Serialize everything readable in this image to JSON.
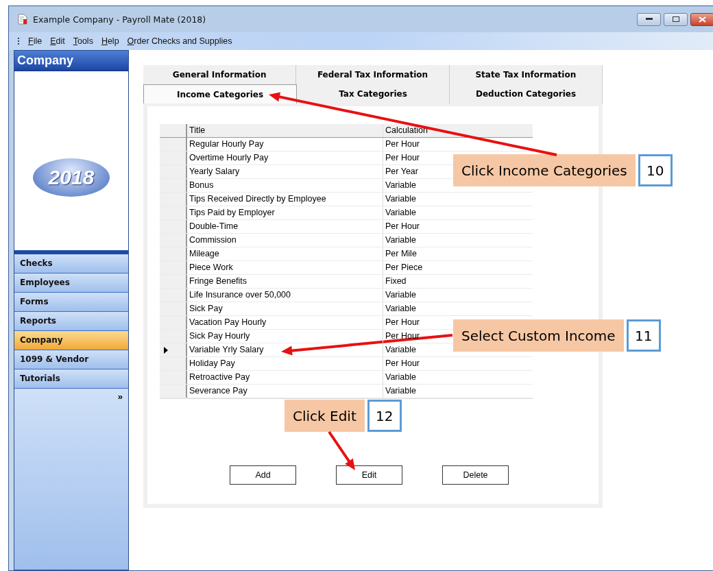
{
  "window": {
    "title": "Example Company - Payroll Mate (2018)"
  },
  "menu": [
    "File",
    "Edit",
    "Tools",
    "Help",
    "Order Checks and Supplies"
  ],
  "sidebar": {
    "header": "Company",
    "logo_text": "2018",
    "items": [
      {
        "label": "Checks",
        "selected": false
      },
      {
        "label": "Employees",
        "selected": false
      },
      {
        "label": "Forms",
        "selected": false
      },
      {
        "label": "Reports",
        "selected": false
      },
      {
        "label": "Company",
        "selected": true
      },
      {
        "label": "1099 & Vendor",
        "selected": false
      },
      {
        "label": "Tutorials",
        "selected": false
      }
    ],
    "more": "»"
  },
  "tabs": [
    [
      {
        "label": "General Information",
        "selected": false
      },
      {
        "label": "Federal Tax Information",
        "selected": false
      },
      {
        "label": "State Tax Information",
        "selected": false
      }
    ],
    [
      {
        "label": "Income Categories",
        "selected": true
      },
      {
        "label": "Tax Categories",
        "selected": false
      },
      {
        "label": "Deduction Categories",
        "selected": false
      }
    ]
  ],
  "table": {
    "columns": [
      "Title",
      "Calculation"
    ],
    "rows": [
      {
        "title": "Regular Hourly Pay",
        "calculation": "Per Hour",
        "selected": false
      },
      {
        "title": "Overtime Hourly Pay",
        "calculation": "Per Hour",
        "selected": false
      },
      {
        "title": "Yearly Salary",
        "calculation": "Per Year",
        "selected": false
      },
      {
        "title": "Bonus",
        "calculation": "Variable",
        "selected": false
      },
      {
        "title": "Tips Received Directly by Employee",
        "calculation": "Variable",
        "selected": false
      },
      {
        "title": "Tips Paid by Employer",
        "calculation": "Variable",
        "selected": false
      },
      {
        "title": "Double-Time",
        "calculation": "Per Hour",
        "selected": false
      },
      {
        "title": "Commission",
        "calculation": "Variable",
        "selected": false
      },
      {
        "title": "Mileage",
        "calculation": "Per Mile",
        "selected": false
      },
      {
        "title": "Piece Work",
        "calculation": "Per Piece",
        "selected": false
      },
      {
        "title": "Fringe Benefits",
        "calculation": "Fixed",
        "selected": false
      },
      {
        "title": "Life Insurance over 50,000",
        "calculation": "Variable",
        "selected": false
      },
      {
        "title": "Sick Pay",
        "calculation": "Variable",
        "selected": false
      },
      {
        "title": "Vacation Pay Hourly",
        "calculation": "Per Hour",
        "selected": false
      },
      {
        "title": "Sick Pay Hourly",
        "calculation": "Per Hour",
        "selected": false
      },
      {
        "title": "Variable Yrly Salary",
        "calculation": "Variable",
        "selected": true
      },
      {
        "title": "Holiday Pay",
        "calculation": "Per Hour",
        "selected": false
      },
      {
        "title": "Retroactive Pay",
        "calculation": "Variable",
        "selected": false
      },
      {
        "title": "Severance Pay",
        "calculation": "Variable",
        "selected": false
      }
    ]
  },
  "buttons": [
    "Add",
    "Edit",
    "Delete"
  ],
  "callouts": [
    {
      "text": "Click Income Categories",
      "step": "10"
    },
    {
      "text": "Select Custom Income",
      "step": "11"
    },
    {
      "text": "Click Edit",
      "step": "12"
    }
  ]
}
